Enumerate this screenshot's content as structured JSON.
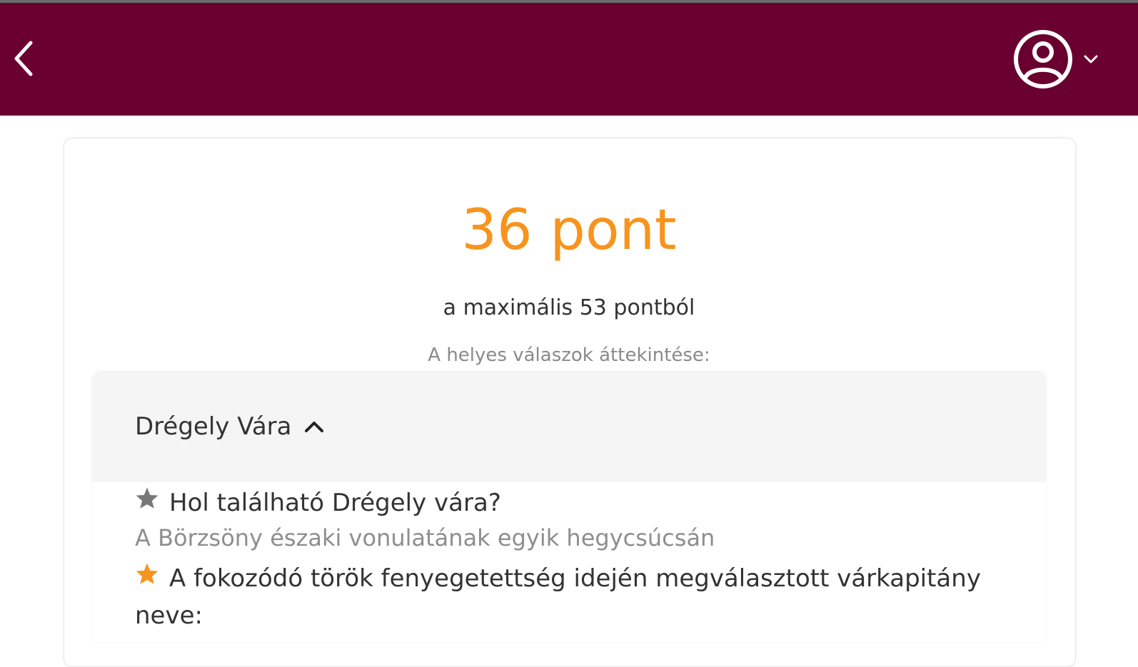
{
  "header": {
    "bg_color": "#6a0030",
    "back_icon": "chevron-left-icon",
    "user_icon": "user-circle-icon",
    "dropdown_icon": "chevron-down-icon"
  },
  "result": {
    "score": "36 pont",
    "score_color": "#f7941d",
    "subtitle": "a maximális 53 pontból",
    "review_label": "A helyes válaszok áttekintése:"
  },
  "accordion": {
    "title": "Drégely Vára",
    "items": [
      {
        "star_color": "#777777",
        "question": "Hol található Drégely vára?",
        "answer": "A Börzsöny északi vonulatának egyik hegycsúcsán"
      },
      {
        "star_color": "#f7941d",
        "question": "A fokozódó török fenyegetettség idején megválasztott várkapitány neve:",
        "answer": ""
      }
    ]
  }
}
